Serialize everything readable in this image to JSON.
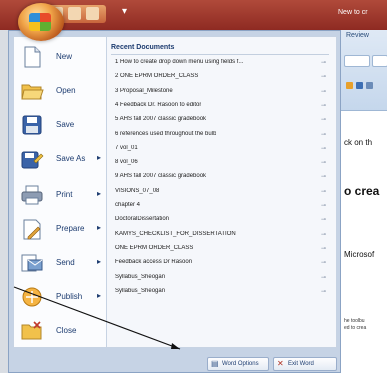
{
  "window": {
    "title_fragment": "New to cr"
  },
  "background_doc": {
    "ribbon_tab": "Review",
    "lines": [
      {
        "text": "ck on th",
        "style": "normal"
      },
      {
        "text": "o crea",
        "style": "big"
      },
      {
        "text": "Microsof",
        "style": "normal"
      },
      {
        "text": "he toolbu",
        "style": "small"
      },
      {
        "text": "ed to crea",
        "style": "small"
      }
    ]
  },
  "office_menu": {
    "commands": [
      {
        "label": "New",
        "icon": "new-document-icon",
        "submenu": false
      },
      {
        "label": "Open",
        "icon": "open-folder-icon",
        "submenu": false
      },
      {
        "label": "Save",
        "icon": "save-disk-icon",
        "submenu": false
      },
      {
        "label": "Save As",
        "icon": "save-as-icon",
        "submenu": true
      },
      {
        "label": "Print",
        "icon": "printer-icon",
        "submenu": true
      },
      {
        "label": "Prepare",
        "icon": "prepare-icon",
        "submenu": true
      },
      {
        "label": "Send",
        "icon": "send-icon",
        "submenu": true
      },
      {
        "label": "Publish",
        "icon": "publish-icon",
        "submenu": true
      },
      {
        "label": "Close",
        "icon": "close-folder-icon",
        "submenu": false
      }
    ],
    "recent_header": "Recent Documents",
    "recent_documents": [
      "1 How to create drop down menu using fields f...",
      "2 ONE EPRM ORDER_CLASS",
      "3 Proposal_Milestone",
      "4 Feedback Dr. Rasoon  to editor",
      "5 AHS fall 2007 classic gradebook",
      "6 references used throughout the bulb",
      "7 vol_01",
      "8 vol_06",
      "9 AHS fall 2007 classic gradebook",
      "VISIONS_07_08",
      "chapter 4",
      "DoctoralDissertation",
      "KAMYS_CHECKLIST_FOR_DISSERTATION",
      "ONE EPRM ORDER_CLASS",
      "Feedback access Dr Rasoon",
      "Syllabus_Sheogan",
      "Syllabus_Sheogan"
    ],
    "footer": {
      "options_label": "Word Options",
      "exit_label": "Exit Word"
    }
  },
  "colors": {
    "titlebar": "#9b3528",
    "menu_bg": "#c6d3e5",
    "accent": "#1d3c70"
  }
}
